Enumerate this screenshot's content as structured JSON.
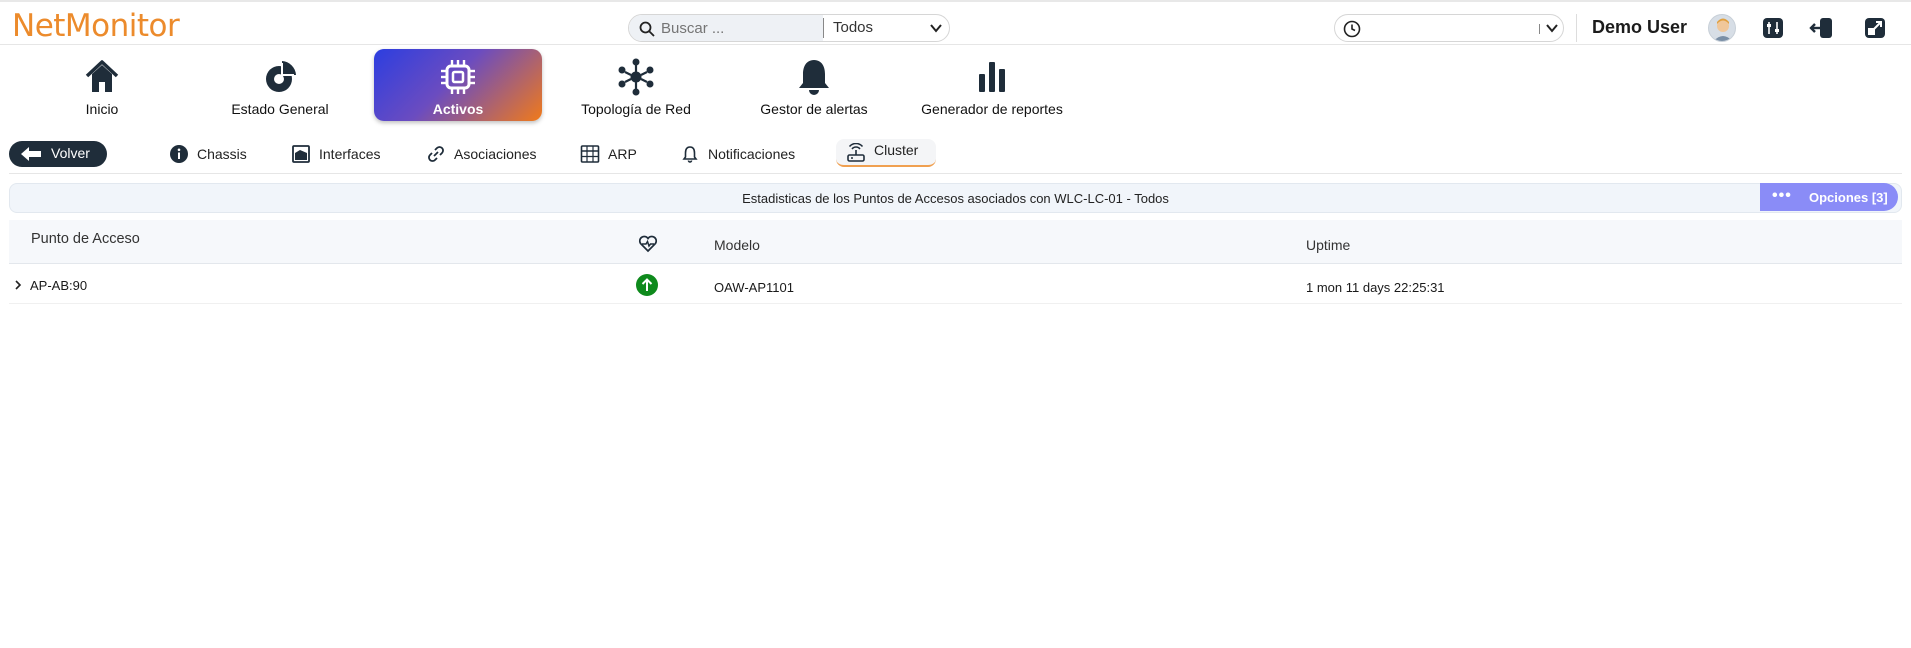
{
  "app": {
    "logo_text": "NetMonitor",
    "logo_color": "#ec8b2c"
  },
  "search": {
    "placeholder": "Buscar ...",
    "scope_value": "Todos"
  },
  "time_selector": {
    "value": ""
  },
  "user": {
    "name": "Demo User"
  },
  "nav": {
    "items": [
      {
        "label": "Inicio",
        "icon": "home-icon"
      },
      {
        "label": "Estado General",
        "icon": "chart-donut-icon"
      },
      {
        "label": "Activos",
        "icon": "chip-icon",
        "active": true
      },
      {
        "label": "Topología de Red",
        "icon": "network-icon"
      },
      {
        "label": "Gestor de alertas",
        "icon": "bell-icon"
      },
      {
        "label": "Generador de reportes",
        "icon": "bar-chart-icon"
      }
    ]
  },
  "subnav": {
    "back_label": "Volver",
    "tabs": [
      {
        "label": "Chassis",
        "icon": "info-icon"
      },
      {
        "label": "Interfaces",
        "icon": "interface-icon"
      },
      {
        "label": "Asociaciones",
        "icon": "link-icon"
      },
      {
        "label": "ARP",
        "icon": "table-icon"
      },
      {
        "label": "Notificaciones",
        "icon": "bell-small-icon"
      },
      {
        "label": "Cluster",
        "icon": "router-icon",
        "active": true
      }
    ]
  },
  "panel": {
    "title": "Estadisticas de los Puntos de Accesos asociados con WLC-LC-01 - Todos",
    "options_label": "Opciones [3]",
    "options_color": "#8a8cf7"
  },
  "table": {
    "columns": {
      "ap": "Punto de Acceso",
      "status": "heart-status-icon",
      "model": "Modelo",
      "uptime": "Uptime"
    },
    "rows": [
      {
        "ap": "AP-AB:90",
        "status": "up",
        "status_color": "#0e8a1c",
        "model": "OAW-AP1101",
        "uptime": "1 mon 11 days 22:25:31"
      }
    ]
  }
}
